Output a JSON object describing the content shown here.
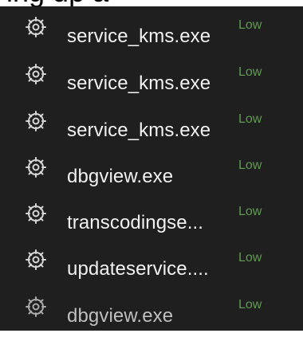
{
  "header": {
    "partial_text": "ing up a"
  },
  "processes": {
    "risk_color": "#5e9c4f",
    "icon_name": "gear-icon",
    "items": [
      {
        "name": "service_kms.exe",
        "risk": "Low"
      },
      {
        "name": "service_kms.exe",
        "risk": "Low"
      },
      {
        "name": "service_kms.exe",
        "risk": "Low"
      },
      {
        "name": "dbgview.exe",
        "risk": "Low"
      },
      {
        "name": "transcodingse...",
        "risk": "Low"
      },
      {
        "name": "updateservice....",
        "risk": "Low"
      },
      {
        "name": "dbgview.exe",
        "risk": "Low"
      }
    ]
  }
}
